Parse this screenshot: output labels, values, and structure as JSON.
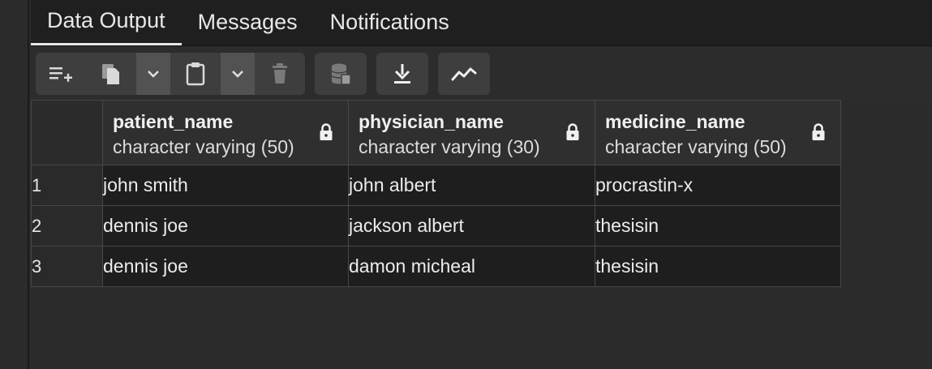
{
  "tabs": [
    {
      "label": "Data Output",
      "active": true
    },
    {
      "label": "Messages",
      "active": false
    },
    {
      "label": "Notifications",
      "active": false
    }
  ],
  "toolbar": {
    "icons": [
      "add-row-icon",
      "copy-icon",
      "chevron-down-icon",
      "paste-icon",
      "chevron-down-icon",
      "delete-icon",
      "save-data-icon",
      "download-icon",
      "graph-visualiser-icon"
    ]
  },
  "table": {
    "columns": [
      {
        "name": "patient_name",
        "type": "character varying (50)"
      },
      {
        "name": "physician_name",
        "type": "character varying (30)"
      },
      {
        "name": "medicine_name",
        "type": "character varying (50)"
      }
    ],
    "rows": [
      {
        "num": "1",
        "cells": [
          "john smith",
          "john albert",
          "procrastin-x"
        ]
      },
      {
        "num": "2",
        "cells": [
          "dennis joe",
          "jackson albert",
          "thesisin"
        ]
      },
      {
        "num": "3",
        "cells": [
          "dennis joe",
          "damon micheal",
          "thesisin"
        ]
      }
    ]
  },
  "colors": {
    "background": "#2b2b2b",
    "tab_bar": "#1f1f1f",
    "button": "#3e3e3e",
    "cell": "#1e1e1e",
    "border": "#474747",
    "text": "#ececec"
  }
}
